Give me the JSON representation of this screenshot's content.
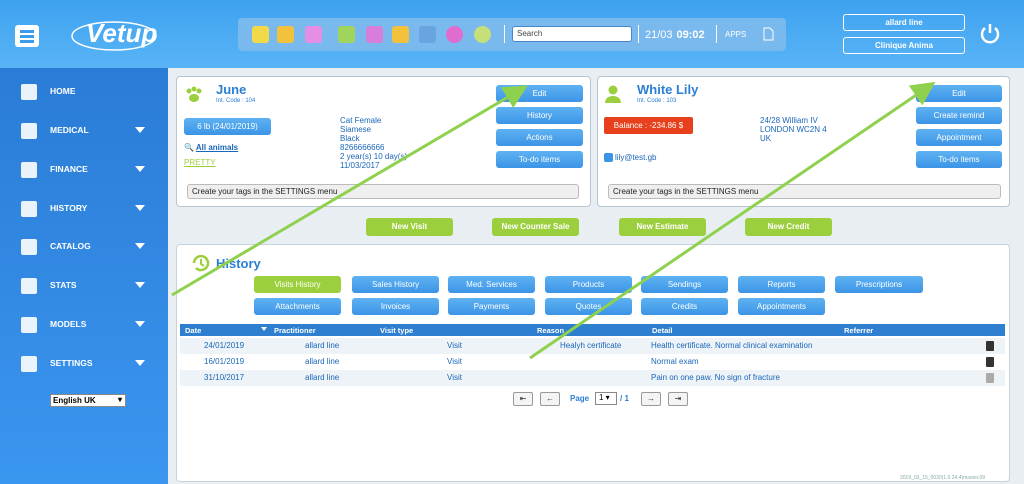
{
  "app": {
    "logo": "Vetup"
  },
  "header": {
    "search_placeholder": "Search",
    "date": "21/03",
    "time": "09:02",
    "apps_label": "APPS",
    "user_label": "allard line",
    "clinic_label": "Clinique Anima"
  },
  "sidebar": {
    "items": [
      {
        "label": "HOME",
        "icon": "home-icon",
        "chevron": false
      },
      {
        "label": "MEDICAL",
        "icon": "medical-icon",
        "chevron": true
      },
      {
        "label": "FINANCE",
        "icon": "finance-icon",
        "chevron": true
      },
      {
        "label": "HISTORY",
        "icon": "history-icon",
        "chevron": true
      },
      {
        "label": "CATALOG",
        "icon": "catalog-icon",
        "chevron": true
      },
      {
        "label": "STATS",
        "icon": "stats-icon",
        "chevron": true
      },
      {
        "label": "MODELS",
        "icon": "models-icon",
        "chevron": true
      },
      {
        "label": "SETTINGS",
        "icon": "settings-icon",
        "chevron": true
      }
    ],
    "language": "English UK"
  },
  "patient": {
    "name": "June",
    "int_code": "Int. Code : 104",
    "weight": "6 lb (24/01/2019)",
    "all_animals": "All animals",
    "tag": "PRETTY",
    "details": [
      "Cat Female",
      "Siamese",
      "Black",
      "8266666666",
      "2 year(s) 10 day(s)",
      "11/03/2017"
    ],
    "tags_hint": "Create your tags in the SETTINGS menu",
    "buttons": [
      "Edit",
      "History",
      "Actions",
      "To-do items"
    ]
  },
  "owner": {
    "name": "White Lily",
    "int_code": "Int. Code : 103",
    "balance": "Balance : -234.86 $",
    "email": "lily@test.gb",
    "address": [
      "24/28 William IV",
      "LONDON WC2N 4",
      "UK"
    ],
    "tags_hint": "Create your tags in the SETTINGS menu",
    "buttons": [
      "Edit",
      "Create remind",
      "Appointment",
      "To-do items"
    ]
  },
  "actions": [
    "New Visit",
    "New Counter Sale",
    "New Estimate",
    "New Credit"
  ],
  "history": {
    "title": "History",
    "tabs_row1": [
      "Visits History",
      "Sales History",
      "Med. Services",
      "Products",
      "Sendings",
      "Reports",
      "Prescriptions"
    ],
    "tabs_row2": [
      "Attachments",
      "Invoices",
      "Payments",
      "Quotes",
      "Credits",
      "Appointments"
    ],
    "columns": [
      "Date",
      "Practitioner",
      "Visit type",
      "Reason",
      "Detail",
      "Referrer"
    ],
    "rows": [
      {
        "date": "24/01/2019",
        "practitioner": "allard line",
        "visit_type": "Visit",
        "reason": "Healyh certificate",
        "detail": "Health certificate. Normal clinical examination",
        "referrer": ""
      },
      {
        "date": "16/01/2019",
        "practitioner": "allard line",
        "visit_type": "Visit",
        "reason": "",
        "detail": "Normal exam",
        "referrer": ""
      },
      {
        "date": "31/10/2017",
        "practitioner": "allard line",
        "visit_type": "Visit",
        "reason": "",
        "detail": "Pain on one paw. No sign of fracture",
        "referrer": ""
      }
    ],
    "pager": {
      "label": "Page",
      "page": "1",
      "total": "/ 1"
    }
  },
  "footer": "2019_03_15_0030(1.0.24.4)master.09",
  "colors": {
    "primary": "#3c94e6",
    "green": "#9ccf3d",
    "red": "#e8401c",
    "arrow": "#8fd14f"
  }
}
